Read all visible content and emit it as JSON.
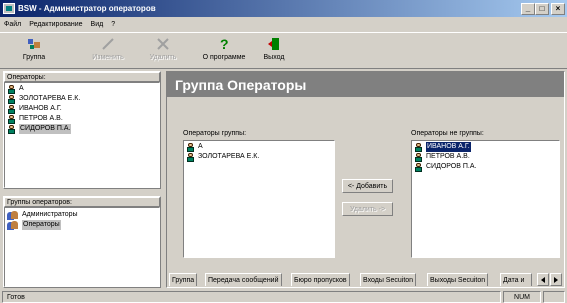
{
  "window": {
    "title": "BSW - Администратор операторов",
    "min": "_",
    "max": "□",
    "close": "×"
  },
  "menu": [
    "Файл",
    "Редактирование",
    "Вид",
    "?"
  ],
  "toolbar": {
    "group": "Группа",
    "edit": "Изменить",
    "delete": "Удалить",
    "about": "О программе",
    "exit": "Выход"
  },
  "operators_panel": {
    "label": "Операторы:",
    "items": [
      "А",
      "ЗОЛОТАРЕВА Е.К.",
      "ИВАНОВ А.Г.",
      "ПЕТРОВ А.В.",
      "СИДОРОВ П.А."
    ]
  },
  "groups_panel": {
    "label": "Группы операторов:",
    "items": [
      "Администраторы",
      "Операторы"
    ]
  },
  "main": {
    "header": "Группа Операторы",
    "in_group_label": "Операторы группы:",
    "in_group": [
      "А",
      "ЗОЛОТАРЕВА Е.К."
    ],
    "not_in_group_label": "Операторы не группы:",
    "not_in_group": [
      "ИВАНОВ А.Г.",
      "ПЕТРОВ А.В.",
      "СИДОРОВ П.А."
    ],
    "add_button": "<- Добавить",
    "remove_button": "Удалить ->"
  },
  "tabs": [
    "Группа",
    "Передача сообщений",
    "Бюро пропусков",
    "Входы Secuiton",
    "Выходы Secuiton",
    "Дата и"
  ],
  "status": {
    "text": "Готов",
    "num": "NUM"
  }
}
